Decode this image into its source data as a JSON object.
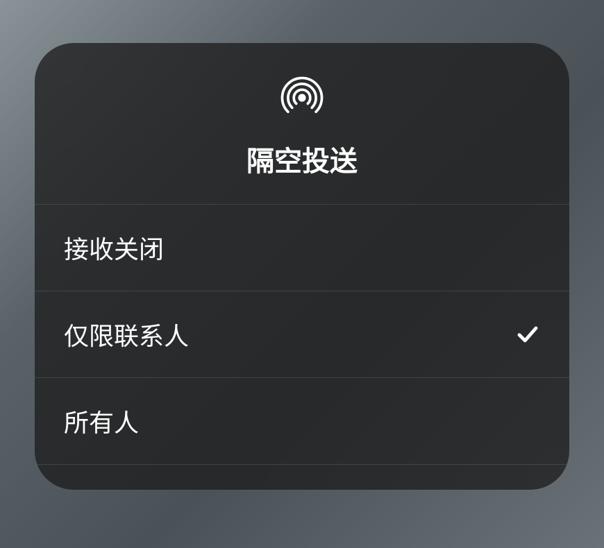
{
  "panel": {
    "title": "隔空投送",
    "icon": "airdrop-icon",
    "options": [
      {
        "label": "接收关闭",
        "selected": false
      },
      {
        "label": "仅限联系人",
        "selected": true
      },
      {
        "label": "所有人",
        "selected": false
      }
    ]
  }
}
